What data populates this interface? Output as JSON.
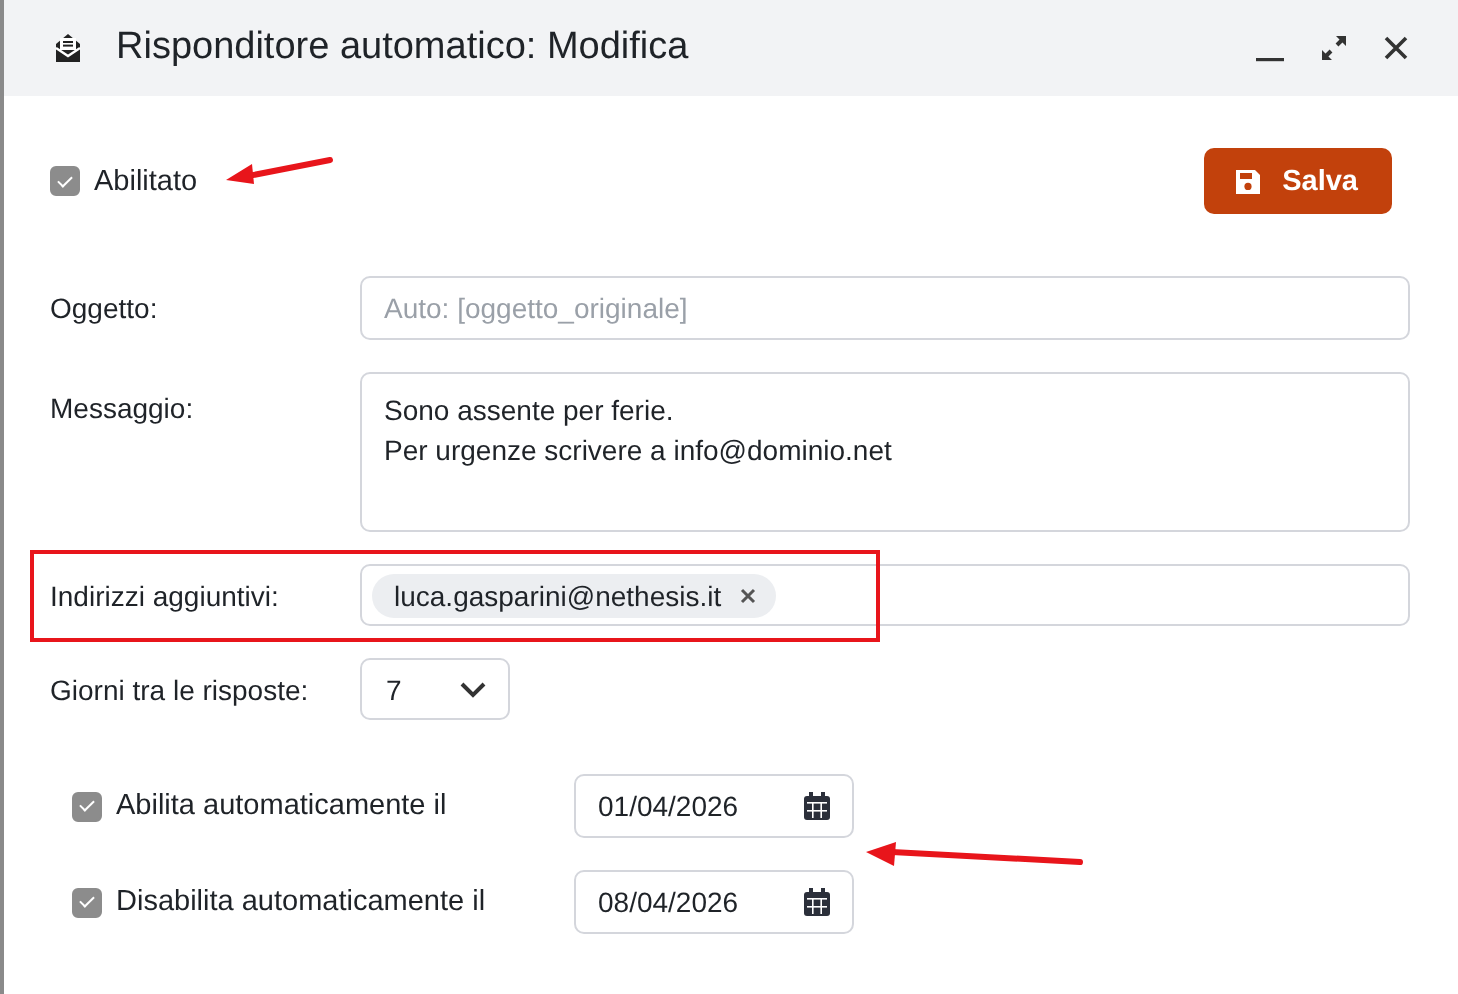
{
  "window": {
    "title": "Risponditore automatico: Modifica"
  },
  "enabled": {
    "label": "Abilitato",
    "checked": true
  },
  "save_button": {
    "label": "Salva"
  },
  "fields": [
    {
      "kind": "input",
      "label": "Oggetto:",
      "placeholder": "Auto: [oggetto_originale]"
    },
    {
      "kind": "textarea",
      "label": "Messaggio:",
      "value": "Sono assente per ferie.\nPer urgenze scrivere a info@dominio.net"
    },
    {
      "kind": "tags",
      "label": "Indirizzi aggiuntivi:",
      "tags": [
        "luca.gasparini@nethesis.it"
      ]
    },
    {
      "kind": "select",
      "label": "Giorni tra le risposte:",
      "value": "7"
    }
  ],
  "schedule": [
    {
      "label": "Abilita automaticamente il",
      "checked": true,
      "date": "01/04/2026"
    },
    {
      "label": "Disabilita automaticamente il",
      "checked": true,
      "date": "08/04/2026"
    }
  ]
}
